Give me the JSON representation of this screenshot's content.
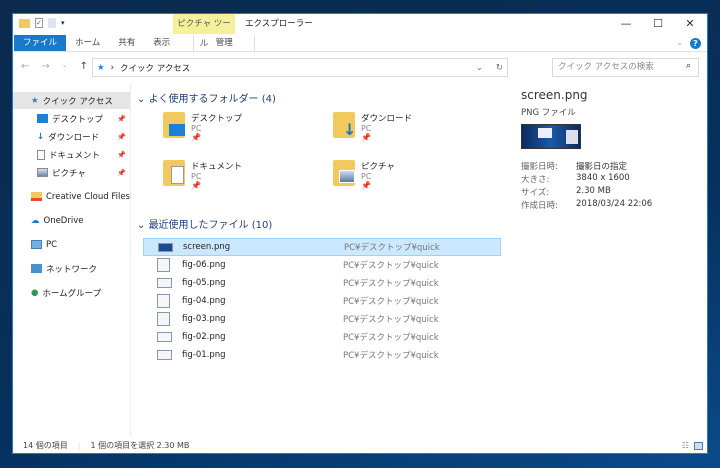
{
  "ribbon": {
    "context_group": "ピクチャ ツール",
    "app_title": "エクスプローラー",
    "tabs": [
      "ファイル",
      "ホーム",
      "共有",
      "表示"
    ],
    "context_tab": "管理"
  },
  "address": {
    "path": "クイック アクセス",
    "search_placeholder": "クイック アクセスの検索"
  },
  "sidebar": {
    "items": [
      {
        "label": "クイック アクセス"
      },
      {
        "label": "デスクトップ"
      },
      {
        "label": "ダウンロード"
      },
      {
        "label": "ドキュメント"
      },
      {
        "label": "ピクチャ"
      },
      {
        "label": "Creative Cloud Files"
      },
      {
        "label": "OneDrive"
      },
      {
        "label": "PC"
      },
      {
        "label": "ネットワーク"
      },
      {
        "label": "ホームグループ"
      }
    ]
  },
  "frequent": {
    "heading": "よく使用するフォルダー (4)",
    "folders": [
      {
        "name": "デスクトップ",
        "location": "PC"
      },
      {
        "name": "ダウンロード",
        "location": "PC"
      },
      {
        "name": "ドキュメント",
        "location": "PC"
      },
      {
        "name": "ピクチャ",
        "location": "PC"
      }
    ]
  },
  "recent": {
    "heading": "最近使用したファイル (10)",
    "files": [
      {
        "name": "screen.png",
        "path": "PC¥デスクトップ¥quick"
      },
      {
        "name": "fig-06.png",
        "path": "PC¥デスクトップ¥quick"
      },
      {
        "name": "fig-05.png",
        "path": "PC¥デスクトップ¥quick"
      },
      {
        "name": "fig-04.png",
        "path": "PC¥デスクトップ¥quick"
      },
      {
        "name": "fig-03.png",
        "path": "PC¥デスクトップ¥quick"
      },
      {
        "name": "fig-02.png",
        "path": "PC¥デスクトップ¥quick"
      },
      {
        "name": "fig-01.png",
        "path": "PC¥デスクトップ¥quick"
      }
    ]
  },
  "details": {
    "name": "screen.png",
    "type": "PNG ファイル",
    "props": [
      {
        "label": "撮影日時:",
        "value": "撮影日の指定"
      },
      {
        "label": "大きさ:",
        "value": "3840 x 1600"
      },
      {
        "label": "サイズ:",
        "value": "2.30 MB"
      },
      {
        "label": "作成日時:",
        "value": "2018/03/24 22:06"
      }
    ]
  },
  "status": {
    "count": "14 個の項目",
    "selection": "1 個の項目を選択  2.30 MB"
  }
}
